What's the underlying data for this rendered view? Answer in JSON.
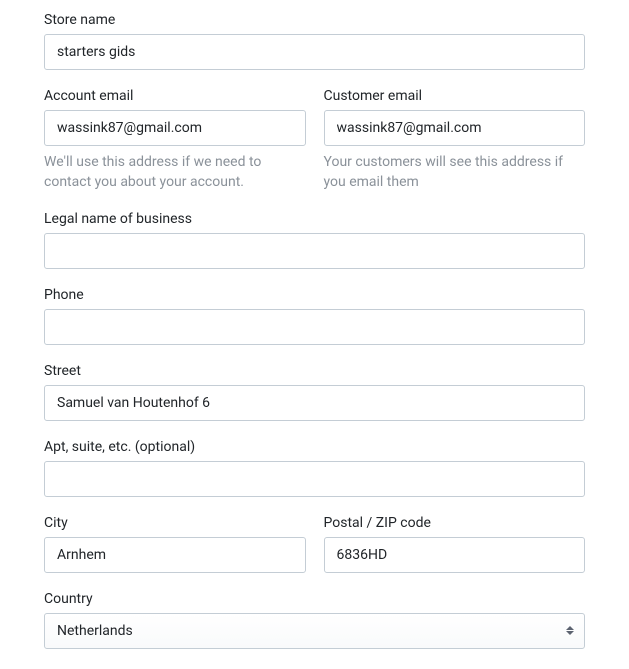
{
  "store_name": {
    "label": "Store name",
    "value": "starters gids"
  },
  "account_email": {
    "label": "Account email",
    "value": "wassink87@gmail.com",
    "helper": "We'll use this address if we need to contact you about your account."
  },
  "customer_email": {
    "label": "Customer email",
    "value": "wassink87@gmail.com",
    "helper": "Your customers will see this address if you email them"
  },
  "legal_name": {
    "label": "Legal name of business",
    "value": ""
  },
  "phone": {
    "label": "Phone",
    "value": ""
  },
  "street": {
    "label": "Street",
    "value": "Samuel van Houtenhof 6"
  },
  "apt": {
    "label": "Apt, suite, etc. (optional)",
    "value": ""
  },
  "city": {
    "label": "City",
    "value": "Arnhem"
  },
  "postal": {
    "label": "Postal / ZIP code",
    "value": "6836HD"
  },
  "country": {
    "label": "Country",
    "selected": "Netherlands"
  }
}
